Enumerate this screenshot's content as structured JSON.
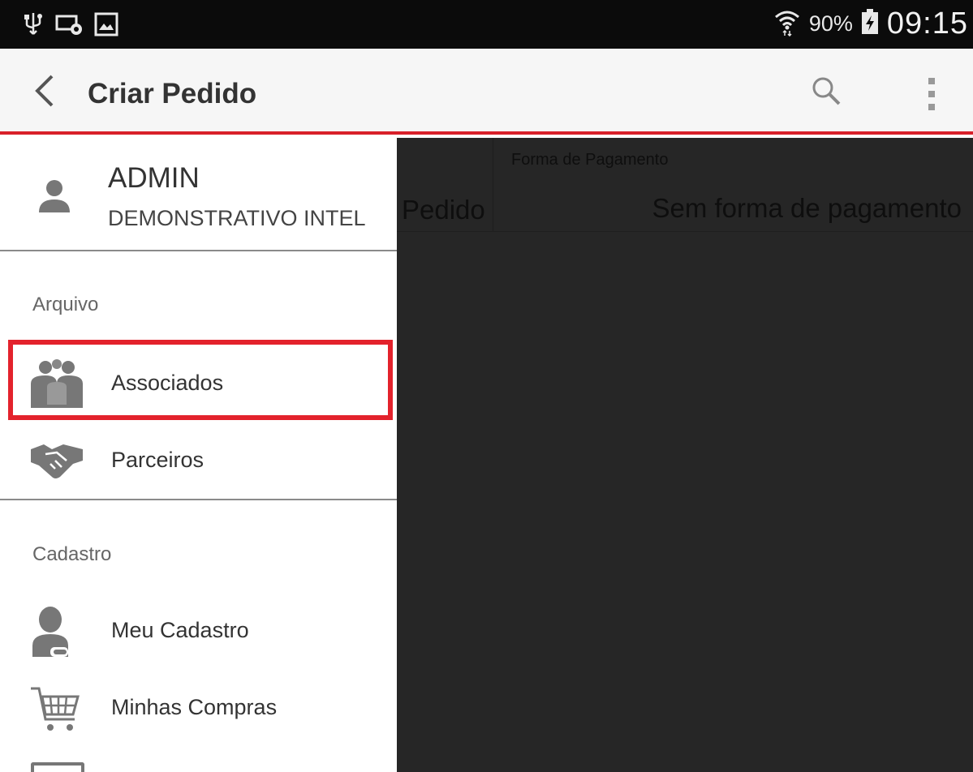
{
  "status_bar": {
    "battery_text": "90%",
    "clock": "09:15",
    "icons": [
      "usb-icon",
      "cast-icon",
      "gallery-icon",
      "wifi-icon",
      "battery-charging-icon"
    ]
  },
  "action_bar": {
    "title": "Criar Pedido",
    "icons": [
      "back-arrow-icon",
      "search-icon",
      "overflow-menu-icon"
    ],
    "accent_color": "#d8202a"
  },
  "drawer": {
    "user": {
      "name": "ADMIN",
      "company": "DEMONSTRATIVO INTEL"
    },
    "sections": [
      {
        "label": "Arquivo",
        "items": [
          {
            "label": "Associados",
            "icon": "group-icon",
            "highlighted": true
          },
          {
            "label": "Parceiros",
            "icon": "handshake-icon"
          }
        ]
      },
      {
        "label": "Cadastro",
        "items": [
          {
            "label": "Meu Cadastro",
            "icon": "user-profile-icon"
          },
          {
            "label": "Minhas Compras",
            "icon": "shopping-cart-icon"
          }
        ]
      }
    ],
    "highlight_color": "#e3222c"
  },
  "main": {
    "left_column_text": "Pedido",
    "field_caption": "Forma de Pagamento",
    "field_value": "Sem forma de pagamento"
  }
}
